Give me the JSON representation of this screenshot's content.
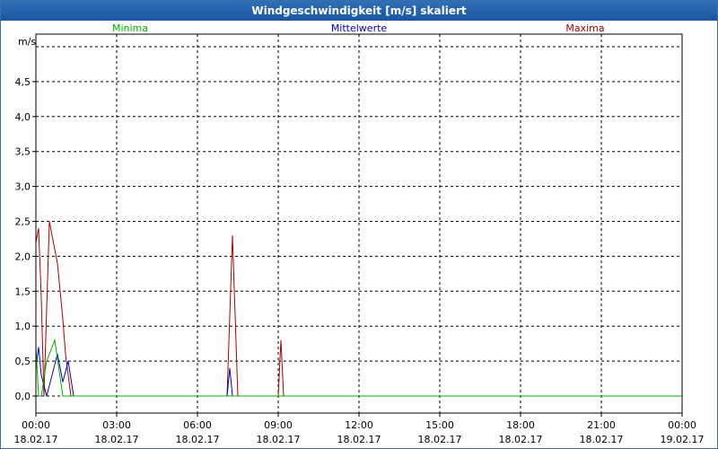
{
  "window": {
    "title": "Windgeschwindigkeit [m/s] skaliert"
  },
  "colors": {
    "min": "#00b000",
    "mean": "#0000cc",
    "max": "#aa0000",
    "grid": "#000000"
  },
  "chart_data": {
    "type": "line",
    "title": "Windgeschwindigkeit [m/s] skaliert",
    "ylabel": "m/s",
    "ylim": [
      0,
      5
    ],
    "y_ticks": [
      "0,0",
      "0,5",
      "1,0",
      "1,5",
      "2,0",
      "2,5",
      "3,0",
      "3,5",
      "4,0",
      "4,5"
    ],
    "x_ticks": [
      {
        "time": "00:00",
        "date": "18.02.17"
      },
      {
        "time": "03:00",
        "date": "18.02.17"
      },
      {
        "time": "06:00",
        "date": "18.02.17"
      },
      {
        "time": "09:00",
        "date": "18.02.17"
      },
      {
        "time": "12:00",
        "date": "18.02.17"
      },
      {
        "time": "15:00",
        "date": "18.02.17"
      },
      {
        "time": "18:00",
        "date": "18.02.17"
      },
      {
        "time": "21:00",
        "date": "18.02.17"
      },
      {
        "time": "00:00",
        "date": "19.02.17"
      }
    ],
    "grid": true,
    "legend_position": "top",
    "x_unit": "hours since 18.02.17 00:00",
    "series": [
      {
        "name": "Minima",
        "x": [
          0,
          0.1,
          0.2,
          0.4,
          0.7,
          1,
          1.3,
          24
        ],
        "values": [
          0.7,
          0,
          0,
          0.5,
          0.8,
          0,
          0,
          0
        ]
      },
      {
        "name": "Mittelwerte",
        "x": [
          0,
          0.1,
          0.2,
          0.4,
          0.6,
          0.8,
          1,
          1.2,
          1.4,
          7,
          7.1,
          7.2,
          7.3,
          7.5,
          24
        ],
        "values": [
          0.4,
          0.7,
          0.3,
          0,
          0.3,
          0.6,
          0.2,
          0.5,
          0,
          0,
          0,
          0.4,
          0,
          0,
          0
        ]
      },
      {
        "name": "Maxima",
        "x": [
          0,
          0.1,
          0.2,
          0.3,
          0.5,
          0.6,
          0.8,
          1,
          1.1,
          1.3,
          1.4,
          1.6,
          7,
          7.1,
          7.3,
          7.5,
          8,
          9,
          9.1,
          9.2,
          9.3,
          9.5,
          24
        ],
        "values": [
          2.2,
          2.4,
          1.4,
          0,
          2.5,
          2.3,
          1.9,
          1.1,
          0.6,
          0,
          0,
          0,
          0,
          0,
          2.3,
          0,
          0,
          0,
          0.8,
          0,
          0,
          0,
          0
        ]
      }
    ]
  }
}
